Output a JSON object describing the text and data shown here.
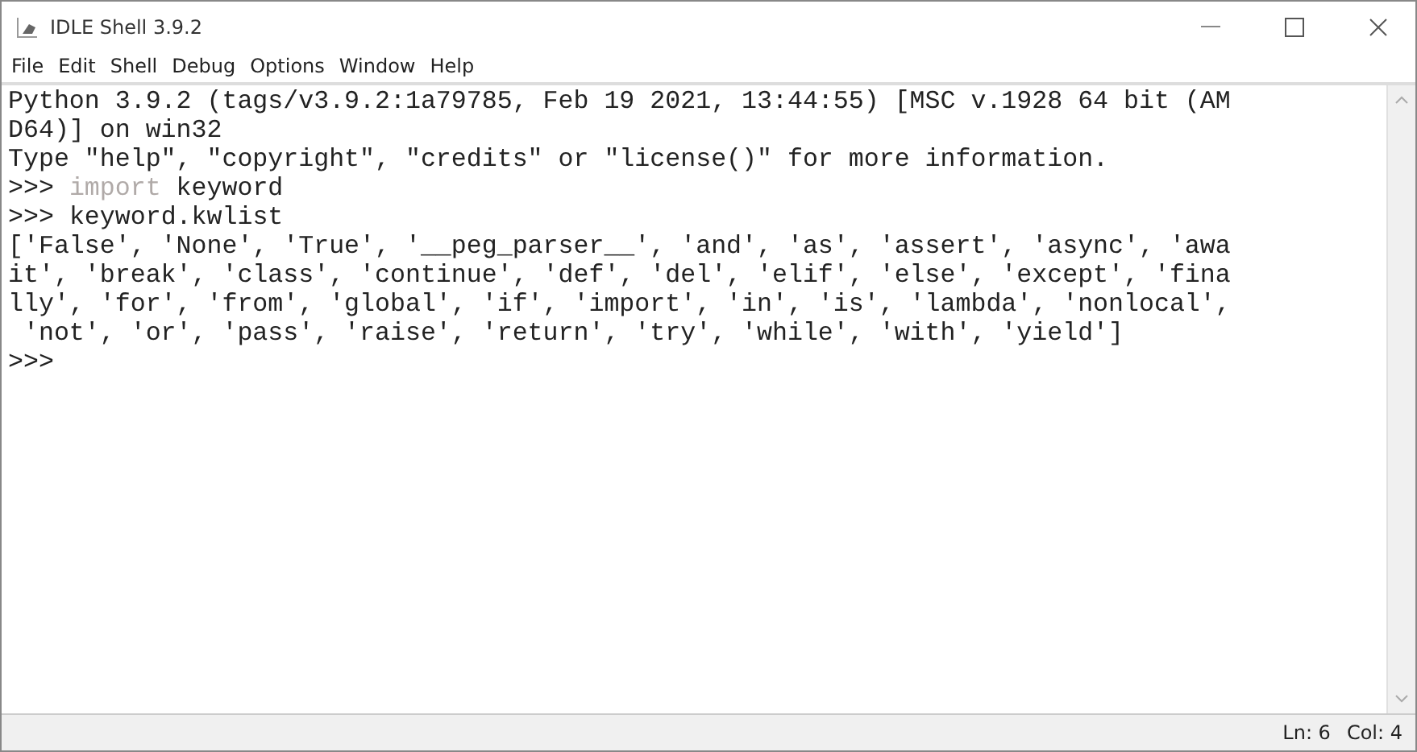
{
  "window": {
    "title": "IDLE Shell 3.9.2"
  },
  "menu": [
    "File",
    "Edit",
    "Shell",
    "Debug",
    "Options",
    "Window",
    "Help"
  ],
  "shell_lines": [
    {
      "kind": "output",
      "text": "Python 3.9.2 (tags/v3.9.2:1a79785, Feb 19 2021, 13:44:55) [MSC v.1928 64 bit (AM"
    },
    {
      "kind": "output",
      "text": "D64)] on win32"
    },
    {
      "kind": "output",
      "text": "Type \"help\", \"copyright\", \"credits\" or \"license()\" for more information."
    },
    {
      "kind": "input",
      "prompt": ">>>",
      "parts": [
        {
          "kind": "keyword",
          "text": "import"
        },
        {
          "kind": "plain",
          "text": " keyword"
        }
      ]
    },
    {
      "kind": "input",
      "prompt": ">>>",
      "parts": [
        {
          "kind": "plain",
          "text": "keyword.kwlist"
        }
      ]
    },
    {
      "kind": "output",
      "text": "['False', 'None', 'True', '__peg_parser__', 'and', 'as', 'assert', 'async', 'awa"
    },
    {
      "kind": "output",
      "text": "it', 'break', 'class', 'continue', 'def', 'del', 'elif', 'else', 'except', 'fina"
    },
    {
      "kind": "output",
      "text": "lly', 'for', 'from', 'global', 'if', 'import', 'in', 'is', 'lambda', 'nonlocal',"
    },
    {
      "kind": "output",
      "text": " 'not', 'or', 'pass', 'raise', 'return', 'try', 'while', 'with', 'yield']"
    },
    {
      "kind": "input",
      "prompt": ">>>"
    }
  ],
  "status_bar": {
    "line": "Ln: 6",
    "column": "Col: 4"
  }
}
